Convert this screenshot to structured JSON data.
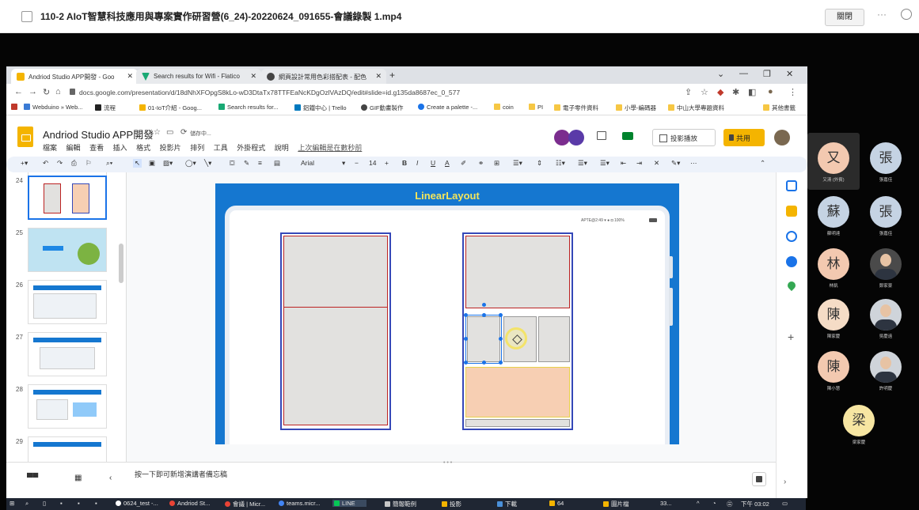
{
  "teams": {
    "title": "110-2 AIoT智慧科技應用與專案實作研習營(6_24)-20220624_091655-會議錄製 1.mp4",
    "close_label": "關閉",
    "more_label": "···"
  },
  "browser": {
    "tabs": [
      {
        "label": "Andriod Studio APP開發 - Goo",
        "favicon_color": "#f4b400"
      },
      {
        "label": "Search results for Wifi - Flatico",
        "favicon_color": "#19a974"
      },
      {
        "label": "網頁設計常用色彩搭配表 - 配色",
        "favicon_color": "#444444"
      }
    ],
    "new_tab": "+",
    "url": "docs.google.com/presentation/d/18dNhXFOpgS8kLo-wD3DtaTx78TTFEaNcKDgOzlVAzDQ/edit#slide=id.g135da8687ec_0_577",
    "bookmarks": [
      {
        "label": "Webduino » Web...",
        "color": "#3a7bd5"
      },
      {
        "label": "流程",
        "color": "#222222"
      },
      {
        "label": "01-IoT介紹 - Goog...",
        "color": "#f4b400"
      },
      {
        "label": "Search results for...",
        "color": "#19a974"
      },
      {
        "label": "鋁鐵中心 | Trello",
        "color": "#0079bf"
      },
      {
        "label": "GIF動畫製作",
        "color": "#444444"
      },
      {
        "label": "Create a palette -...",
        "color": "#1a73e8"
      },
      {
        "label": "coin",
        "color": "#f6c744"
      },
      {
        "label": "PI",
        "color": "#f6c744"
      },
      {
        "label": "電子零件資料",
        "color": "#f6c744"
      },
      {
        "label": "小學-編碼器",
        "color": "#f6c744"
      },
      {
        "label": "中山大學專題資料",
        "color": "#f6c744"
      },
      {
        "label": "其他書籤",
        "color": "#f6c744"
      }
    ]
  },
  "slides": {
    "doc_title": "Andriod Studio APP開發",
    "saving": "儲存中...",
    "menu": [
      "檔案",
      "編輯",
      "查看",
      "插入",
      "格式",
      "投影片",
      "排列",
      "工具",
      "外掛程式",
      "說明"
    ],
    "last_edit": "上次編輯是在數秒前",
    "present_label": "投影播放",
    "share_label": "共用",
    "toolbar": {
      "font": "Arial",
      "font_size": "14",
      "bold": "B",
      "italic": "I",
      "underline": "U",
      "text_color": "A"
    },
    "slide_numbers": [
      "24",
      "25",
      "26",
      "27",
      "28",
      "29"
    ],
    "selected_slide": "24",
    "slide_title": "LinearLayout",
    "status_time": "APTE@2:49",
    "status_battery": "100%",
    "notes": "按一下即可新增演講者備忘稿"
  },
  "taskbar": {
    "items": [
      {
        "label": "0624_test -...",
        "color": "#ffffff"
      },
      {
        "label": "Andriod St...",
        "color": "#ea4335"
      },
      {
        "label": "會議 | Micr...",
        "color": "#ea4335"
      },
      {
        "label": "teams.micr...",
        "color": "#4285f4"
      },
      {
        "label": "LINE",
        "color": "#06c755"
      },
      {
        "label": "簡報範例",
        "color": "#c7c7c7"
      },
      {
        "label": "投影",
        "color": "#f4b400"
      },
      {
        "label": "下載",
        "color": "#4a90d9"
      },
      {
        "label": "64",
        "color": "#f4b400"
      },
      {
        "label": "圖片檔",
        "color": "#f4b400"
      }
    ],
    "weather": "33...",
    "clock": "下午 03:02"
  },
  "participants": [
    {
      "initial": "又",
      "name": "又清 (外賓)",
      "color": "#f3c9b0"
    },
    {
      "initial": "張",
      "name": "張嘉佳",
      "color": "#c5d3e3"
    },
    {
      "initial": "蘇",
      "name": "蘇明達",
      "color": "#c5d3e3"
    },
    {
      "initial": "張",
      "name": "張嘉佳",
      "color": "#c5d3e3"
    },
    {
      "initial": "林",
      "name": "林凱",
      "color": "#f3c9b0"
    },
    {
      "initial": "",
      "name": "鄭家豪",
      "color": "#4a4a4a"
    },
    {
      "initial": "陳",
      "name": "陳家慶",
      "color": "#f5dcc6"
    },
    {
      "initial": "",
      "name": "吳慶遠",
      "color": "#cfd4da"
    },
    {
      "initial": "陳",
      "name": "陳小慧",
      "color": "#f3c9b0"
    },
    {
      "initial": "",
      "name": "許明慶",
      "color": "#cfd4da"
    },
    {
      "initial": "梁",
      "name": "梁家慶",
      "color": "#f7e6a2"
    }
  ]
}
